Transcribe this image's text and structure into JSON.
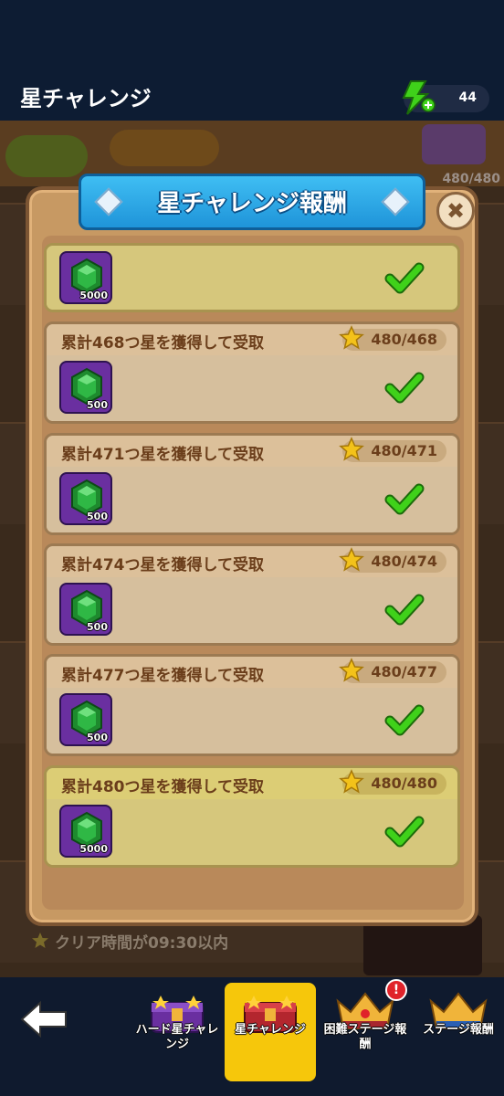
{
  "header": {
    "title": "星チャレンジ",
    "energy": "44"
  },
  "background": {
    "progress": "480/480",
    "clear_condition": "クリア時間が09:30以内"
  },
  "modal": {
    "title": "星チャレンジ報酬",
    "rewards": [
      {
        "label": "",
        "progress": "",
        "qty": "5000",
        "claimed": true,
        "highlight": true
      },
      {
        "label": "累計468つ星を獲得して受取",
        "progress": "480/468",
        "qty": "500",
        "claimed": true,
        "highlight": false
      },
      {
        "label": "累計471つ星を獲得して受取",
        "progress": "480/471",
        "qty": "500",
        "claimed": true,
        "highlight": false
      },
      {
        "label": "累計474つ星を獲得して受取",
        "progress": "480/474",
        "qty": "500",
        "claimed": true,
        "highlight": false
      },
      {
        "label": "累計477つ星を獲得して受取",
        "progress": "480/477",
        "qty": "500",
        "claimed": true,
        "highlight": false
      },
      {
        "label": "累計480つ星を獲得して受取",
        "progress": "480/480",
        "qty": "5000",
        "claimed": true,
        "highlight": true
      }
    ]
  },
  "nav": {
    "tabs": [
      {
        "label": "ハード星チャレンジ",
        "active": false
      },
      {
        "label": "星チャレンジ",
        "active": true
      },
      {
        "label": "困難ステージ報酬",
        "active": false,
        "badge": "!"
      },
      {
        "label": "ステージ報酬",
        "active": false
      }
    ]
  },
  "colors": {
    "accent": "#f6c70b",
    "banner": "#2aa8e8",
    "check": "#3fd11a",
    "gem": "#1e8a2e"
  }
}
